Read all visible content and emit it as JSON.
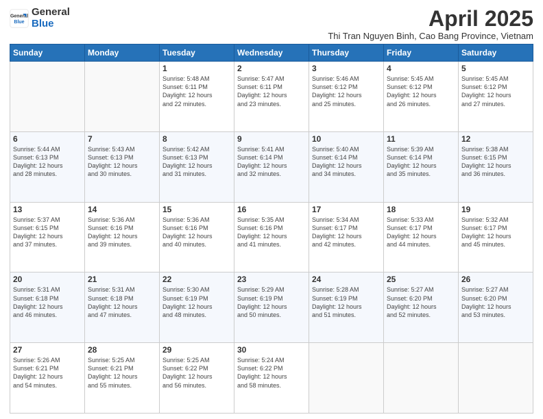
{
  "logo": {
    "general": "General",
    "blue": "Blue"
  },
  "title": "April 2025",
  "subtitle": "Thi Tran Nguyen Binh, Cao Bang Province, Vietnam",
  "days_of_week": [
    "Sunday",
    "Monday",
    "Tuesday",
    "Wednesday",
    "Thursday",
    "Friday",
    "Saturday"
  ],
  "weeks": [
    [
      {
        "day": "",
        "info": ""
      },
      {
        "day": "",
        "info": ""
      },
      {
        "day": "1",
        "info": "Sunrise: 5:48 AM\nSunset: 6:11 PM\nDaylight: 12 hours\nand 22 minutes."
      },
      {
        "day": "2",
        "info": "Sunrise: 5:47 AM\nSunset: 6:11 PM\nDaylight: 12 hours\nand 23 minutes."
      },
      {
        "day": "3",
        "info": "Sunrise: 5:46 AM\nSunset: 6:12 PM\nDaylight: 12 hours\nand 25 minutes."
      },
      {
        "day": "4",
        "info": "Sunrise: 5:45 AM\nSunset: 6:12 PM\nDaylight: 12 hours\nand 26 minutes."
      },
      {
        "day": "5",
        "info": "Sunrise: 5:45 AM\nSunset: 6:12 PM\nDaylight: 12 hours\nand 27 minutes."
      }
    ],
    [
      {
        "day": "6",
        "info": "Sunrise: 5:44 AM\nSunset: 6:13 PM\nDaylight: 12 hours\nand 28 minutes."
      },
      {
        "day": "7",
        "info": "Sunrise: 5:43 AM\nSunset: 6:13 PM\nDaylight: 12 hours\nand 30 minutes."
      },
      {
        "day": "8",
        "info": "Sunrise: 5:42 AM\nSunset: 6:13 PM\nDaylight: 12 hours\nand 31 minutes."
      },
      {
        "day": "9",
        "info": "Sunrise: 5:41 AM\nSunset: 6:14 PM\nDaylight: 12 hours\nand 32 minutes."
      },
      {
        "day": "10",
        "info": "Sunrise: 5:40 AM\nSunset: 6:14 PM\nDaylight: 12 hours\nand 34 minutes."
      },
      {
        "day": "11",
        "info": "Sunrise: 5:39 AM\nSunset: 6:14 PM\nDaylight: 12 hours\nand 35 minutes."
      },
      {
        "day": "12",
        "info": "Sunrise: 5:38 AM\nSunset: 6:15 PM\nDaylight: 12 hours\nand 36 minutes."
      }
    ],
    [
      {
        "day": "13",
        "info": "Sunrise: 5:37 AM\nSunset: 6:15 PM\nDaylight: 12 hours\nand 37 minutes."
      },
      {
        "day": "14",
        "info": "Sunrise: 5:36 AM\nSunset: 6:16 PM\nDaylight: 12 hours\nand 39 minutes."
      },
      {
        "day": "15",
        "info": "Sunrise: 5:36 AM\nSunset: 6:16 PM\nDaylight: 12 hours\nand 40 minutes."
      },
      {
        "day": "16",
        "info": "Sunrise: 5:35 AM\nSunset: 6:16 PM\nDaylight: 12 hours\nand 41 minutes."
      },
      {
        "day": "17",
        "info": "Sunrise: 5:34 AM\nSunset: 6:17 PM\nDaylight: 12 hours\nand 42 minutes."
      },
      {
        "day": "18",
        "info": "Sunrise: 5:33 AM\nSunset: 6:17 PM\nDaylight: 12 hours\nand 44 minutes."
      },
      {
        "day": "19",
        "info": "Sunrise: 5:32 AM\nSunset: 6:17 PM\nDaylight: 12 hours\nand 45 minutes."
      }
    ],
    [
      {
        "day": "20",
        "info": "Sunrise: 5:31 AM\nSunset: 6:18 PM\nDaylight: 12 hours\nand 46 minutes."
      },
      {
        "day": "21",
        "info": "Sunrise: 5:31 AM\nSunset: 6:18 PM\nDaylight: 12 hours\nand 47 minutes."
      },
      {
        "day": "22",
        "info": "Sunrise: 5:30 AM\nSunset: 6:19 PM\nDaylight: 12 hours\nand 48 minutes."
      },
      {
        "day": "23",
        "info": "Sunrise: 5:29 AM\nSunset: 6:19 PM\nDaylight: 12 hours\nand 50 minutes."
      },
      {
        "day": "24",
        "info": "Sunrise: 5:28 AM\nSunset: 6:19 PM\nDaylight: 12 hours\nand 51 minutes."
      },
      {
        "day": "25",
        "info": "Sunrise: 5:27 AM\nSunset: 6:20 PM\nDaylight: 12 hours\nand 52 minutes."
      },
      {
        "day": "26",
        "info": "Sunrise: 5:27 AM\nSunset: 6:20 PM\nDaylight: 12 hours\nand 53 minutes."
      }
    ],
    [
      {
        "day": "27",
        "info": "Sunrise: 5:26 AM\nSunset: 6:21 PM\nDaylight: 12 hours\nand 54 minutes."
      },
      {
        "day": "28",
        "info": "Sunrise: 5:25 AM\nSunset: 6:21 PM\nDaylight: 12 hours\nand 55 minutes."
      },
      {
        "day": "29",
        "info": "Sunrise: 5:25 AM\nSunset: 6:22 PM\nDaylight: 12 hours\nand 56 minutes."
      },
      {
        "day": "30",
        "info": "Sunrise: 5:24 AM\nSunset: 6:22 PM\nDaylight: 12 hours\nand 58 minutes."
      },
      {
        "day": "",
        "info": ""
      },
      {
        "day": "",
        "info": ""
      },
      {
        "day": "",
        "info": ""
      }
    ]
  ]
}
